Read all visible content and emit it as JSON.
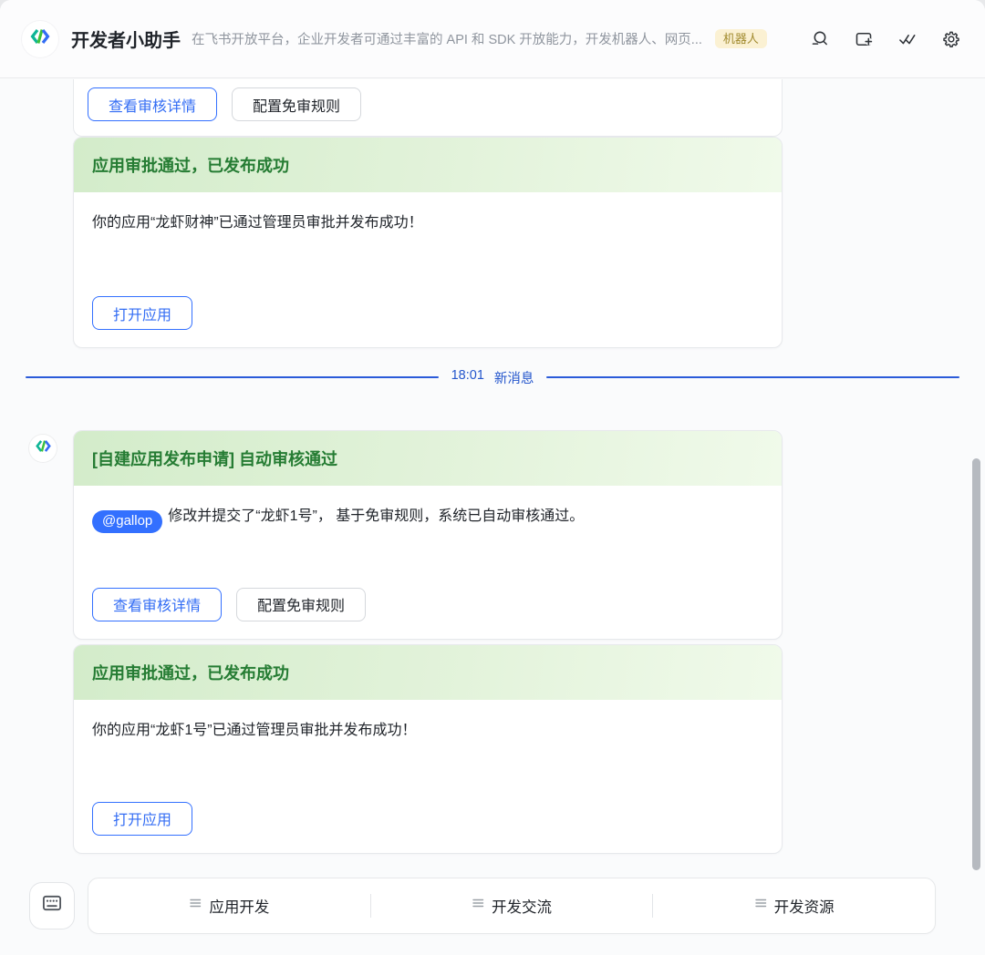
{
  "header": {
    "title": "开发者小助手",
    "subtitle": "在飞书开放平台，企业开发者可通过丰富的 API 和 SDK 开放能力，开发机器人、网页...",
    "badge": "机器人"
  },
  "divider": {
    "time": "18:01",
    "label": "新消息"
  },
  "cards": {
    "partial": {
      "primary_button": "查看审核详情",
      "secondary_button": "配置免审规则"
    },
    "approved1": {
      "title": "应用审批通过，已发布成功",
      "body": "你的应用“龙虾财神”已通过管理员审批并发布成功！",
      "button": "打开应用"
    },
    "request": {
      "title": "[自建应用发布申请] 自动审核通过",
      "mention": "@gallop",
      "body": "修改并提交了“龙虾1号”， 基于免审规则，系统已自动审核通过。",
      "primary_button": "查看审核详情",
      "secondary_button": "配置免审规则"
    },
    "approved2": {
      "title": "应用审批通过，已发布成功",
      "body": "你的应用“龙虾1号”已通过管理员审批并发布成功！",
      "button": "打开应用"
    }
  },
  "footer": {
    "items": [
      {
        "label": "应用开发"
      },
      {
        "label": "开发交流"
      },
      {
        "label": "开发资源"
      }
    ]
  },
  "icons": {
    "logo": "code-brackets-icon",
    "search": "search-icon",
    "add_window": "add-window-icon",
    "read_all": "double-check-icon",
    "settings": "gear-icon",
    "keyboard": "keyboard-icon",
    "menu": "menu-lines-icon"
  },
  "colors": {
    "accent_blue": "#3370ff",
    "success_green": "#257c33",
    "header_gradient_start": "#d3ecca",
    "header_gradient_end": "#f0faea",
    "badge_bg": "#fbf1d3",
    "badge_text": "#a18a2e",
    "divider_blue": "#2b5bd9",
    "scrollbar": "#b6bac0"
  }
}
